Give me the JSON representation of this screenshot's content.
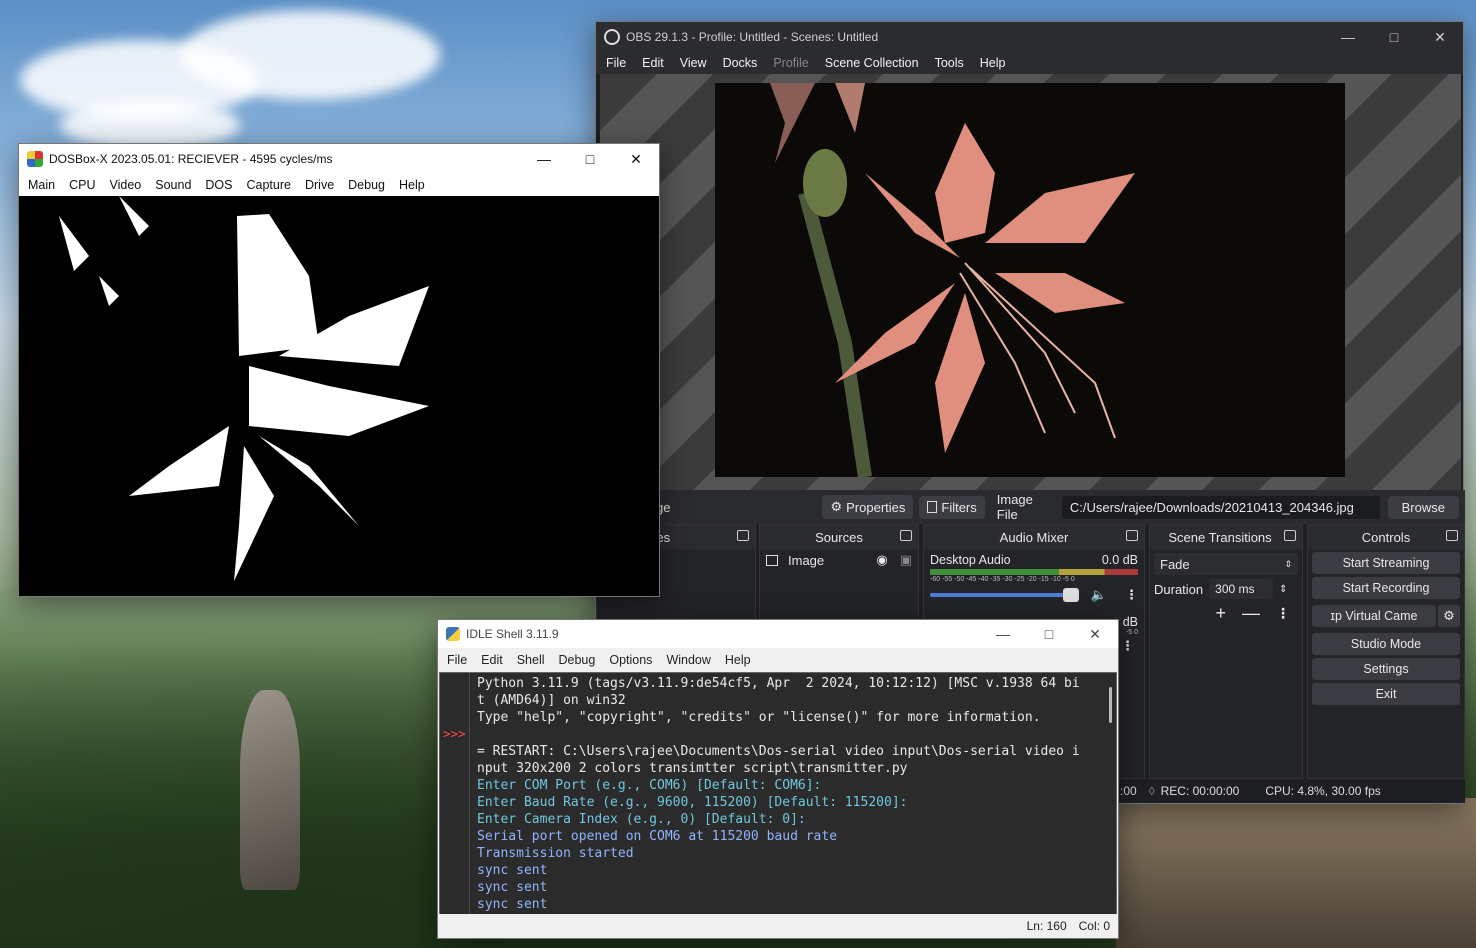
{
  "obs": {
    "title": "OBS 29.1.3 - Profile: Untitled - Scenes: Untitled",
    "menu": [
      "File",
      "Edit",
      "View",
      "Docks",
      "Profile",
      "Scene Collection",
      "Tools",
      "Help"
    ],
    "toolbar": {
      "source_label_fragment": "ge",
      "properties": "Properties",
      "filters": "Filters",
      "image_file_label": "Image File",
      "image_path": "C:/Users/rajee/Downloads/20210413_204346.jpg",
      "browse": "Browse"
    },
    "docks": {
      "scenes_title": "enes",
      "sources_title": "Sources",
      "source_item": "Image",
      "audio_title": "Audio Mixer",
      "audio_channel": "Desktop Audio",
      "audio_level": "0.0 dB",
      "audio_level2": "dB",
      "meter_ticks": "-60 -55 -50 -45 -40 -35 -30 -25 -20 -15 -10 -5 0",
      "meter_ticks2": "-5 0",
      "volume_fraction": 0.92,
      "transitions_title": "Scene Transitions",
      "transition_value": "Fade",
      "duration_label": "Duration",
      "duration_value": "300 ms",
      "controls_title": "Controls",
      "controls": [
        "Start Streaming",
        "Start Recording",
        "ɪp Virtual Came",
        "Studio Mode",
        "Settings",
        "Exit"
      ]
    },
    "status": {
      "live_fragment": ":00",
      "rec": "REC: 00:00:00",
      "cpu": "CPU: 4.8%, 30.00 fps"
    }
  },
  "dosbox": {
    "title": "DOSBox-X 2023.05.01: RECIEVER - 4595 cycles/ms",
    "menu": [
      "Main",
      "CPU",
      "Video",
      "Sound",
      "DOS",
      "Capture",
      "Drive",
      "Debug",
      "Help"
    ]
  },
  "idle": {
    "title": "IDLE Shell 3.11.9",
    "menu": [
      "File",
      "Edit",
      "Shell",
      "Debug",
      "Options",
      "Window",
      "Help"
    ],
    "prompt": ">>>",
    "lines": [
      {
        "text": "Python 3.11.9 (tags/v3.11.9:de54cf5, Apr  2 2024, 10:12:12) [MSC v.1938 64 bi",
        "style": "white"
      },
      {
        "text": "t (AMD64)] on win32",
        "style": "white"
      },
      {
        "text": "Type \"help\", \"copyright\", \"credits\" or \"license()\" for more information.",
        "style": "white"
      },
      {
        "text": "",
        "style": "white"
      },
      {
        "text": "= RESTART: C:\\Users\\rajee\\Documents\\Dos-serial video input\\Dos-serial video i",
        "style": "white"
      },
      {
        "text": "nput 320x200 2 colors transimtter script\\transmitter.py",
        "style": "white"
      },
      {
        "text": "Enter COM Port (e.g., COM6) [Default: COM6]:",
        "style": "cyan"
      },
      {
        "text": "Enter Baud Rate (e.g., 9600, 115200) [Default: 115200]:",
        "style": "cyan"
      },
      {
        "text": "Enter Camera Index (e.g., 0) [Default: 0]:",
        "style": "cyan"
      },
      {
        "text": "Serial port opened on COM6 at 115200 baud rate",
        "style": "blue"
      },
      {
        "text": "Transmission started",
        "style": "blue"
      },
      {
        "text": "sync sent",
        "style": "blue"
      },
      {
        "text": "sync sent",
        "style": "blue"
      },
      {
        "text": "sync sent",
        "style": "blue"
      }
    ],
    "status_ln": "Ln: 160",
    "status_col": "Col: 0"
  },
  "colors": {
    "obs_bg": "#1e1f22",
    "idle_bg": "#2b2b2b",
    "flower": "#d98a78"
  },
  "icons": [
    "obs-logo-icon",
    "dosbox-logo-icon",
    "idle-logo-icon",
    "gear-icon",
    "filter-icon",
    "eye-icon",
    "lock-icon",
    "speaker-icon",
    "kebab-icon",
    "plus-icon",
    "minus-icon",
    "float-icon",
    "minimize-icon",
    "maximize-icon",
    "close-icon"
  ]
}
